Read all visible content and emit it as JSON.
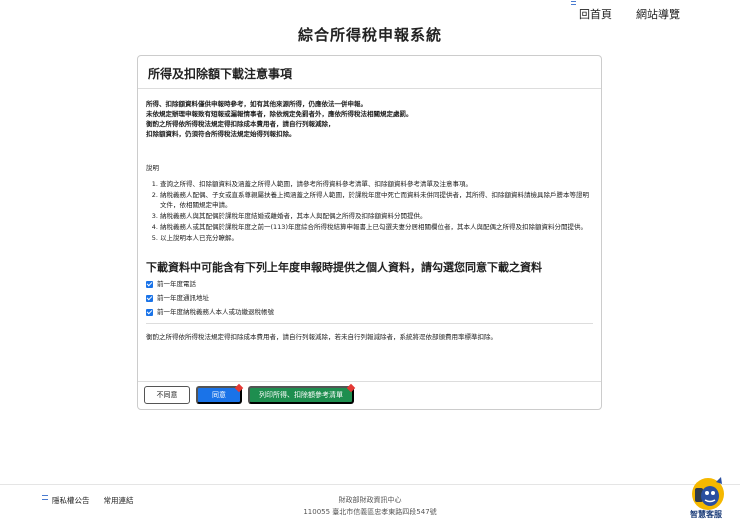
{
  "topnav": {
    "home": "回首頁",
    "sitemap": "網站導覽"
  },
  "system_title": "綜合所得稅申報系統",
  "modal": {
    "title": "所得及扣除額下載注意事項",
    "bold_lines": [
      "所得、扣除額資料僅供申報時參考，如有其他來源所得，仍應依法一併申報。",
      "未依規定辦理申報致有短報或漏報情事者，除依規定免罰者外，應依所得稅法相關規定處罰。",
      "衡酌之所得依所得稅法規定得扣除成本費用者，請自行列報減除，",
      "扣除額資料，仍須符合所得稅法規定始得列報扣除。"
    ],
    "desc_title": "說明",
    "desc_items": [
      "查詢之所得、扣除額資料及涵蓋之所得人範圍，請參考所得資料參考清單、扣除額資料參考清單及注意事項。",
      "納稅義務人配偶、子女或直系尊親屬扶養上揭涵蓋之所得人範圍，於課稅年度中死亡而資料未併同提供者，其所得、扣除額資料請檢具除戶謄本等證明文件，依相關規定申請。",
      "納稅義務人與其配偶於課稅年度結婚或離婚者，其本人與配偶之所得及扣除額資料分開提供。",
      "納稅義務人或其配偶於課稅年度之前一(113)年度綜合所得稅結算申報書上已勾選夫妻分居相關欄位者，其本人與配偶之所得及扣除額資料分開提供。",
      "以上說明本人已充分瞭解。"
    ],
    "consent_title": "下載資料中可能含有下列上年度申報時提供之個人資料，請勾選您同意下載之資料",
    "checkboxes": [
      "前一年度電話",
      "前一年度通訊地址",
      "前一年度納稅義務人本人或功繳退稅帳號"
    ],
    "note": "衡酌之所得依所得稅法規定得扣除成本費用者，請自行列報減除，若未自行列報減除者，系統將逕依部頒費用率標準扣除。",
    "buttons": {
      "decline": "不同意",
      "agree": "同意",
      "print": "列印所得、扣除額參考清單"
    }
  },
  "footer": {
    "links": [
      "隱私權公告",
      "常用連結"
    ],
    "org": "財政部財政資訊中心",
    "address": "110055 臺北市信義區忠孝東路四段547號"
  },
  "assistant": {
    "label": "智慧客服"
  },
  "colors": {
    "primary": "#1a73e8",
    "success": "#1e8e4f",
    "badge": "#e53935"
  }
}
